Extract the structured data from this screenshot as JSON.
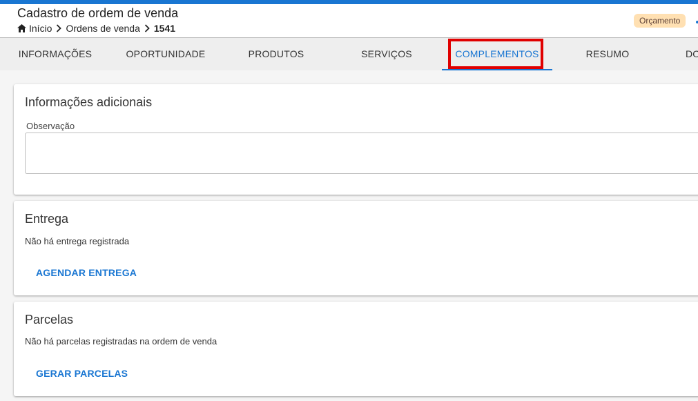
{
  "header": {
    "title": "Cadastro de ordem de venda",
    "breadcrumb": [
      {
        "label": "Início",
        "icon": "home-icon"
      },
      {
        "label": "Ordens de venda"
      },
      {
        "label": "1541"
      }
    ],
    "status": "Orçamento"
  },
  "tabs": [
    {
      "label": "INFORMAÇÕES"
    },
    {
      "label": "OPORTUNIDADE"
    },
    {
      "label": "PRODUTOS"
    },
    {
      "label": "SERVIÇOS"
    },
    {
      "label": "COMPLEMENTOS",
      "active": true
    },
    {
      "label": "RESUMO"
    },
    {
      "label": "DO"
    }
  ],
  "sections": {
    "info": {
      "title": "Informações adicionais",
      "observation_label": "Observação",
      "observation_value": ""
    },
    "delivery": {
      "title": "Entrega",
      "empty_text": "Não há entrega registrada",
      "action": "AGENDAR ENTREGA"
    },
    "installments": {
      "title": "Parcelas",
      "empty_text": "Não há parcelas registradas na ordem de venda",
      "action": "GERAR PARCELAS"
    }
  },
  "colors": {
    "accent": "#1976d2",
    "highlight": "#e00000",
    "badge_bg": "#ffe0b2"
  }
}
